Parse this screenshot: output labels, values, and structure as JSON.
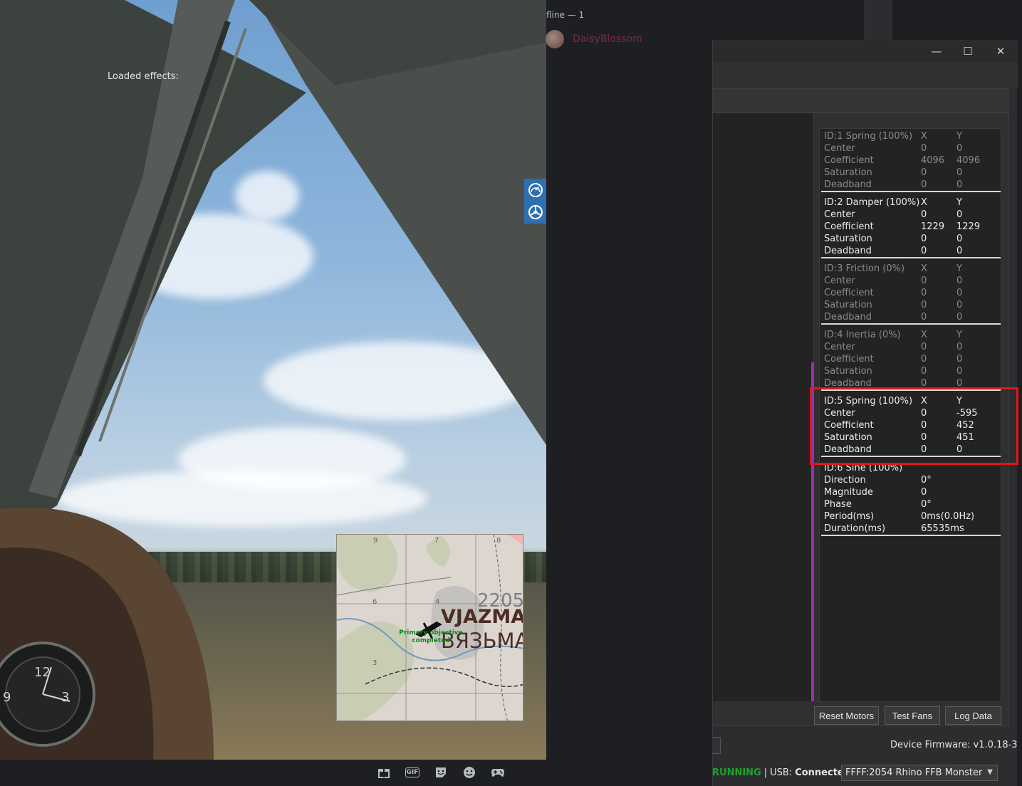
{
  "discord": {
    "offline_header": "fline — 1",
    "member_name": "DaisyBlossom"
  },
  "game": {
    "minimap": {
      "grid_labels": [
        "9",
        "7",
        "8",
        "6",
        "4",
        "3"
      ],
      "city_number": "2205",
      "city_name_latin": "VJAZMA",
      "city_name_cyrillic": "ВЯЗЬМА",
      "objective_text": "Primary objective completed"
    },
    "hud_icons": [
      "speedometer-icon",
      "steering-wheel-icon"
    ]
  },
  "toolbar_icons": [
    "gift-icon",
    "gif-icon",
    "sticker-icon",
    "emoji-icon",
    "gamepad-icon"
  ],
  "toolbar_gif_label": "GIF",
  "window": {
    "minimize": "—",
    "maximize": "☐",
    "close": "✕"
  },
  "effects": {
    "title": "Loaded effects:",
    "list": [
      {
        "header": "ID:1 Spring (100%)",
        "x": "X",
        "y": "Y",
        "dim": true,
        "rows": [
          {
            "label": "Center",
            "x": "0",
            "y": "0"
          },
          {
            "label": "Coefficient",
            "x": "4096",
            "y": "4096"
          },
          {
            "label": "Saturation",
            "x": "0",
            "y": "0"
          },
          {
            "label": "Deadband",
            "x": "0",
            "y": "0"
          }
        ]
      },
      {
        "header": "ID:2 Damper (100%)",
        "x": "X",
        "y": "Y",
        "dim": false,
        "rows": [
          {
            "label": "Center",
            "x": "0",
            "y": "0"
          },
          {
            "label": "Coefficient",
            "x": "1229",
            "y": "1229"
          },
          {
            "label": "Saturation",
            "x": "0",
            "y": "0"
          },
          {
            "label": "Deadband",
            "x": "0",
            "y": "0"
          }
        ]
      },
      {
        "header": "ID:3 Friction (0%)",
        "x": "X",
        "y": "Y",
        "dim": true,
        "rows": [
          {
            "label": "Center",
            "x": "0",
            "y": "0"
          },
          {
            "label": "Coefficient",
            "x": "0",
            "y": "0"
          },
          {
            "label": "Saturation",
            "x": "0",
            "y": "0"
          },
          {
            "label": "Deadband",
            "x": "0",
            "y": "0"
          }
        ]
      },
      {
        "header": "ID:4 Inertia (0%)",
        "x": "X",
        "y": "Y",
        "dim": true,
        "rows": [
          {
            "label": "Center",
            "x": "0",
            "y": "0"
          },
          {
            "label": "Coefficient",
            "x": "0",
            "y": "0"
          },
          {
            "label": "Saturation",
            "x": "0",
            "y": "0"
          },
          {
            "label": "Deadband",
            "x": "0",
            "y": "0"
          }
        ]
      },
      {
        "header": "ID:5 Spring (100%)",
        "x": "X",
        "y": "Y",
        "dim": false,
        "rows": [
          {
            "label": "Center",
            "x": "0",
            "y": "-595"
          },
          {
            "label": "Coefficient",
            "x": "0",
            "y": "452"
          },
          {
            "label": "Saturation",
            "x": "0",
            "y": "451"
          },
          {
            "label": "Deadband",
            "x": "0",
            "y": "0"
          }
        ]
      }
    ],
    "sine": {
      "header": "ID:6 Sine (100%)",
      "rows": [
        {
          "label": "Direction",
          "value": "0°"
        },
        {
          "label": "Magnitude",
          "value": "0"
        },
        {
          "label": "Phase",
          "value": "0°"
        },
        {
          "label": "Period(ms)",
          "value": "0ms(0.0Hz)"
        },
        {
          "label": "Duration(ms)",
          "value": "65535ms"
        }
      ]
    }
  },
  "buttons": {
    "reset_motors": "Reset Motors",
    "test_fans": "Test Fans",
    "log_data": "Log Data"
  },
  "firmware": {
    "label": "Device Firmware:",
    "version": "v1.0.18-3"
  },
  "status": {
    "running": "RUNNING",
    "separator": "|",
    "usb_label": "USB:",
    "usb_value": "Connected",
    "device": "FFFF:2054 Rhino FFB Monster"
  },
  "colors": {
    "running": "#1aa32a",
    "highlight": "#e3161a",
    "graph_bar": "#9b2fae",
    "hud": "#2d6fb0"
  }
}
